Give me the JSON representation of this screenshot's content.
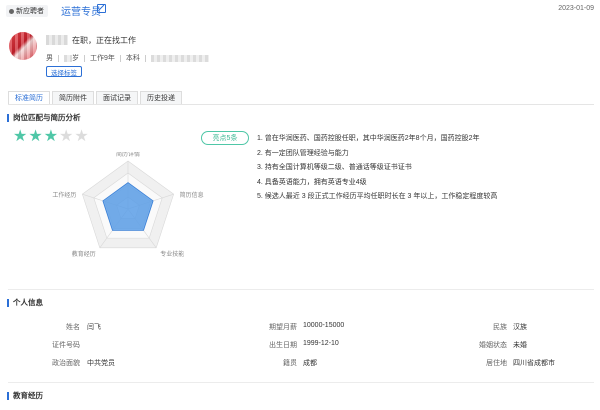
{
  "header": {
    "badge": "新应聘者",
    "job_title": "运营专员",
    "date": "2023-01-09"
  },
  "profile": {
    "status": "在职，正在找工作",
    "gender": "男",
    "age_suffix": "岁",
    "experience": "工作9年",
    "education": "本科",
    "tag_button": "选择标签"
  },
  "tabs": [
    "标准简历",
    "简历附件",
    "面试记录",
    "历史投递"
  ],
  "analysis": {
    "title": "岗位匹配与简历分析",
    "stars_on": 3,
    "stars_total": 5,
    "highlight": "亮点5条",
    "radar_axes": [
      "简历详情",
      "简历信息",
      "专业技能",
      "教育经历",
      "工作经历"
    ],
    "radar_values": [
      0.55,
      0.55,
      0.55,
      0.55,
      0.55
    ],
    "points": [
      "1. 曾在华润医药、国药控股任职，其中华润医药2年8个月，国药控股2年",
      "2. 有一定团队管理经验与能力",
      "3. 持有全国计算机等级二级、普通话等级证书证书",
      "4. 具备英语能力，拥有英语专业4级",
      "5. 候选人最近 3 段正式工作经历平均任职时长在 3 年以上，工作稳定程度较高"
    ]
  },
  "personal": {
    "title": "个人信息",
    "rows": [
      [
        {
          "label": "姓名",
          "value": "闫飞"
        },
        {
          "label": "期望月薪",
          "value": "10000-15000"
        },
        {
          "label": "民族",
          "value": "汉族"
        }
      ],
      [
        {
          "label": "证件号码",
          "value": ""
        },
        {
          "label": "出生日期",
          "value": "1999-12-10"
        },
        {
          "label": "婚姻状态",
          "value": "未婚"
        }
      ],
      [
        {
          "label": "政治面貌",
          "value": "中共党员"
        },
        {
          "label": "籍贯",
          "value": "成都"
        },
        {
          "label": "居住地",
          "value": "四川省成都市"
        }
      ]
    ]
  },
  "education": {
    "title": "教育经历"
  },
  "colors": {
    "accent": "#2b6fd6",
    "green": "#4fc7a7",
    "radar_fill": "#5b9ee6"
  }
}
